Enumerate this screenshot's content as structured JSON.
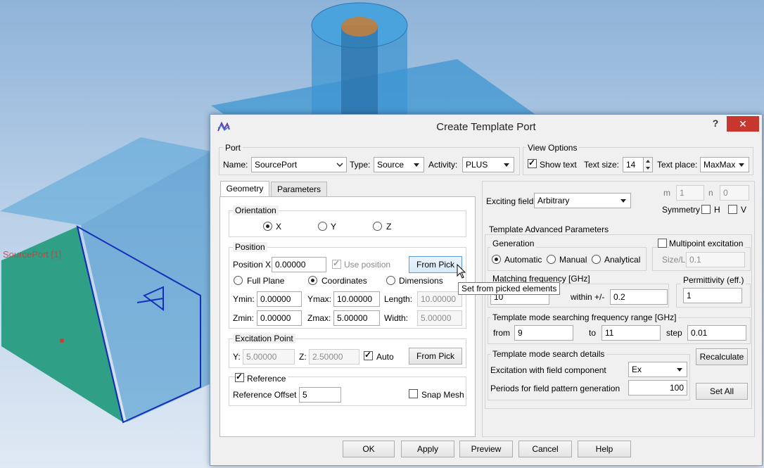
{
  "scene": {
    "part_label": "SourcePort [1]"
  },
  "dialog": {
    "title": "Create Template Port",
    "help_label": "?",
    "close_label": "✕"
  },
  "port": {
    "group_title": "Port",
    "name_label": "Name:",
    "name_value": "SourcePort",
    "type_label": "Type:",
    "type_value": "Source",
    "activity_label": "Activity:",
    "activity_value": "PLUS"
  },
  "view_options": {
    "group_title": "View Options",
    "show_text_label": "Show text",
    "text_size_label": "Text size:",
    "text_size_value": "14",
    "text_place_label": "Text place:",
    "text_place_value": "MaxMax"
  },
  "tabs": [
    "Geometry",
    "Parameters"
  ],
  "orientation": {
    "group_title": "Orientation",
    "options": [
      "X",
      "Y",
      "Z"
    ]
  },
  "position": {
    "group_title": "Position",
    "position_x_label": "Position X",
    "position_x_value": "0.00000",
    "use_position_label": "Use position",
    "from_pick_label": "From Pick",
    "mode_options": [
      "Full Plane",
      "Coordinates",
      "Dimensions"
    ],
    "ymin_label": "Ymin:",
    "ymin_value": "0.00000",
    "ymax_label": "Ymax:",
    "ymax_value": "10.00000",
    "length_label": "Length:",
    "length_value": "10.00000",
    "zmin_label": "Zmin:",
    "zmin_value": "0.00000",
    "zmax_label": "Zmax:",
    "zmax_value": "5.00000",
    "width_label": "Width:",
    "width_value": "5.00000"
  },
  "excitation_point": {
    "group_title": "Excitation Point",
    "y_label": "Y:",
    "y_value": "5.00000",
    "z_label": "Z:",
    "z_value": "2.50000",
    "auto_label": "Auto",
    "from_pick_label": "From Pick"
  },
  "reference": {
    "label": "Reference",
    "offset_label": "Reference Offset",
    "offset_value": "5",
    "snap_mesh_label": "Snap Mesh"
  },
  "tooltip": "Set from picked elements",
  "right": {
    "exciting_field_label": "Exciting field",
    "exciting_field_value": "Arbitrary",
    "m_label": "m",
    "m_value": "1",
    "n_label": "n",
    "n_value": "0",
    "symmetry_label": "Symmetry",
    "h_label": "H",
    "v_label": "V",
    "advanced_title": "Template Advanced Parameters",
    "generation_title": "Generation",
    "generation_options": [
      "Automatic",
      "Manual",
      "Analytical"
    ],
    "multipoint_label": "Multipoint excitation",
    "size_l_label": "Size/L",
    "size_l_value": "0.1",
    "matching_freq_title": "Matching frequency [GHz]",
    "matching_freq_value": "10",
    "within_label": "within +/-",
    "within_value": "0.2",
    "permittivity_title": "Permittivity (eff.)",
    "permittivity_value": "1",
    "search_range_title": "Template mode searching frequency range [GHz]",
    "from_label": "from",
    "from_value": "9",
    "to_label": "to",
    "to_value": "11",
    "step_label": "step",
    "step_value": "0.01",
    "search_details_title": "Template mode search details",
    "excitation_component_label": "Excitation with field component",
    "excitation_component_value": "Ex",
    "periods_label": "Periods for field pattern generation",
    "periods_value": "100",
    "recalculate_label": "Recalculate",
    "set_all_label": "Set All"
  },
  "footer": {
    "ok": "OK",
    "apply": "Apply",
    "preview": "Preview",
    "cancel": "Cancel",
    "help": "Help"
  },
  "colors": {
    "model_blue": "#3d9ad6",
    "port_green": "#2f9f86",
    "close_red": "#c8372d",
    "selection_blue": "#5d9bd6"
  }
}
